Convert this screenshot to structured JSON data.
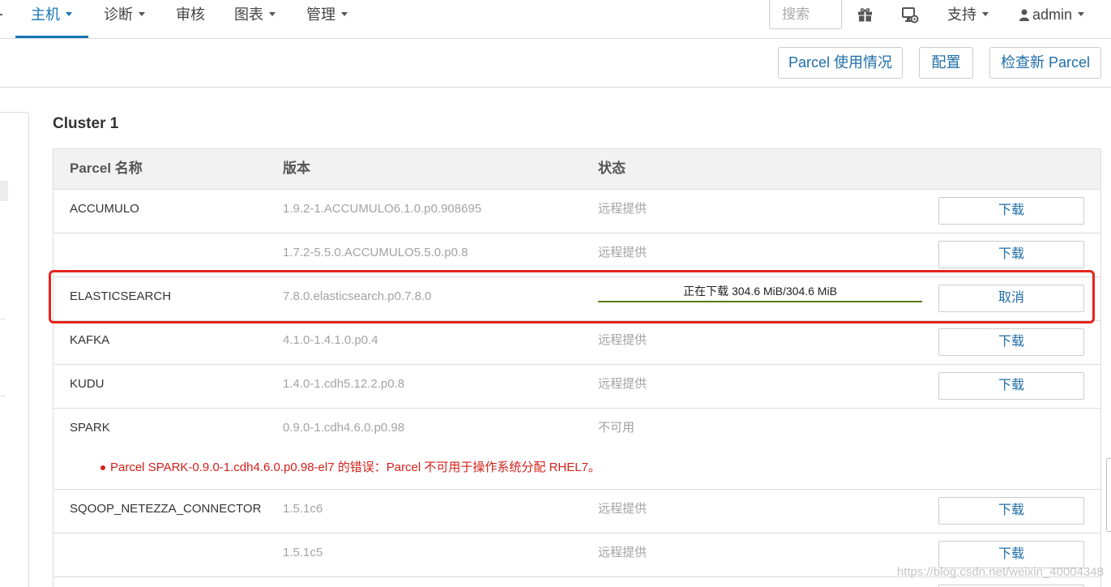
{
  "nav": {
    "items": [
      {
        "label": "主机",
        "has_dropdown": true,
        "active": true
      },
      {
        "label": "诊断",
        "has_dropdown": true,
        "active": false
      },
      {
        "label": "审核",
        "has_dropdown": false,
        "active": false
      },
      {
        "label": "图表",
        "has_dropdown": true,
        "active": false
      },
      {
        "label": "管理",
        "has_dropdown": true,
        "active": false
      }
    ],
    "search_placeholder": "搜索",
    "icons": [
      "gift-icon",
      "monitor-gear-icon"
    ],
    "support_label": "支持",
    "user_icon": "user-icon",
    "user_label": "admin"
  },
  "toolbar": {
    "buttons": [
      "Parcel 使用情况",
      "配置",
      "检查新 Parcel"
    ]
  },
  "cluster": {
    "title": "Cluster 1",
    "columns": [
      "Parcel 名称",
      "版本",
      "状态"
    ],
    "rows": [
      {
        "name": "ACCUMULO",
        "version": "1.9.2-1.ACCUMULO6.1.0.p0.908695",
        "status": "远程提供",
        "action": "下载"
      },
      {
        "version": "1.7.2-5.5.0.ACCUMULO5.5.0.p0.8",
        "status": "远程提供",
        "action": "下载"
      },
      {
        "name": "ELASTICSEARCH",
        "version": "7.8.0.elasticsearch.p0.7.8.0",
        "status": "正在下载 304.6 MiB/304.6 MiB",
        "progress": 1.0,
        "action": "取消",
        "highlighted": true
      },
      {
        "name": "KAFKA",
        "version": "4.1.0-1.4.1.0.p0.4",
        "status": "远程提供",
        "action": "下载"
      },
      {
        "name": "KUDU",
        "version": "1.4.0-1.cdh5.12.2.p0.8",
        "status": "远程提供",
        "action": "下载"
      },
      {
        "name": "SPARK",
        "version": "0.9.0-1.cdh4.6.0.p0.98",
        "status": "不可用",
        "errors": [
          "Parcel SPARK-0.9.0-1.cdh4.6.0.p0.98-el7 的错误：Parcel 不可用于操作系统分配 RHEL7。"
        ]
      },
      {
        "name": "SQOOP_NETEZZA_CONNECTOR",
        "version": "1.5.1c6",
        "status": "远程提供",
        "action": "下载"
      },
      {
        "version": "1.5.1c5",
        "status": "远程提供",
        "action": "下载"
      }
    ]
  },
  "colors": {
    "accent": "#1576b5",
    "link": "#1f6ea8",
    "error": "#d4211b",
    "highlight": "#e6241c",
    "progress": "#567a1c"
  },
  "watermark": "https://blog.csdn.net/weixin_40004348"
}
